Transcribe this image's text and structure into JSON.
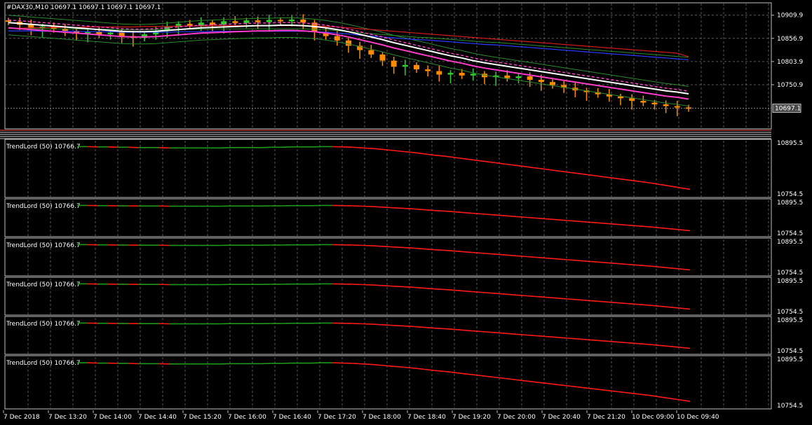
{
  "chart_data": {
    "type": "candlestick",
    "symbol_header": "#DAX30,M10  10697.1 10697.1 10697.1 10697.1",
    "bid_label": "10697.1",
    "price_axis": [
      "10909.9",
      "10856.9",
      "10803.9",
      "10750.9"
    ],
    "ylim": [
      10650,
      10935
    ],
    "x_axis_labels": [
      "7 Dec 2018",
      "7 Dec 13:20",
      "7 Dec 14:00",
      "7 Dec 14:40",
      "7 Dec 15:20",
      "7 Dec 16:00",
      "7 Dec 16:40",
      "7 Dec 17:20",
      "7 Dec 18:00",
      "7 Dec 18:40",
      "7 Dec 19:20",
      "7 Dec 20:00",
      "7 Dec 20:40",
      "7 Dec 21:20",
      "10 Dec 09:00",
      "10 Dec 09:40"
    ],
    "candle_close": [
      10895,
      10888,
      10880,
      10884,
      10878,
      10874,
      10868,
      10872,
      10866,
      10870,
      10862,
      10858,
      10866,
      10874,
      10883,
      10890,
      10886,
      10893,
      10888,
      10896,
      10892,
      10898,
      10894,
      10899,
      10896,
      10900,
      10893,
      10872,
      10862,
      10852,
      10840,
      10830,
      10820,
      10806,
      10792,
      10796,
      10786,
      10782,
      10774,
      10778,
      10772,
      10776,
      10768,
      10772,
      10766,
      10770,
      10762,
      10757,
      10750,
      10744,
      10738,
      10734,
      10729,
      10724,
      10720,
      10714,
      10710,
      10706,
      10702,
      10699,
      10697
    ],
    "ma_white": [
      10893,
      10891,
      10889,
      10887,
      10885,
      10883,
      10881,
      10879,
      10877,
      10875,
      10873,
      10872,
      10872,
      10873,
      10875,
      10877,
      10879,
      10881,
      10882,
      10883,
      10884,
      10885,
      10886,
      10886,
      10887,
      10887,
      10886,
      10884,
      10881,
      10877,
      10872,
      10866,
      10860,
      10854,
      10847,
      10841,
      10835,
      10829,
      10823,
      10817,
      10812,
      10806,
      10801,
      10797,
      10793,
      10789,
      10785,
      10781,
      10777,
      10773,
      10769,
      10765,
      10761,
      10757,
      10753,
      10749,
      10745,
      10741,
      10737,
      10734,
      10730
    ],
    "ma_blue": [
      10874,
      10874,
      10874,
      10873,
      10873,
      10873,
      10873,
      10872,
      10872,
      10872,
      10871,
      10871,
      10871,
      10871,
      10871,
      10872,
      10872,
      10872,
      10873,
      10873,
      10873,
      10873,
      10873,
      10873,
      10873,
      10873,
      10873,
      10872,
      10871,
      10869,
      10867,
      10864,
      10862,
      10860,
      10858,
      10856,
      10854,
      10853,
      10851,
      10849,
      10847,
      10845,
      10843,
      10842,
      10840,
      10838,
      10836,
      10834,
      10832,
      10830,
      10828,
      10826,
      10824,
      10822,
      10820,
      10818,
      10816,
      10814,
      10812,
      10810,
      10808
    ],
    "ma_red": [
      10880,
      10880,
      10881,
      10881,
      10882,
      10882,
      10882,
      10883,
      10883,
      10883,
      10883,
      10883,
      10884,
      10884,
      10884,
      10885,
      10885,
      10885,
      10886,
      10886,
      10886,
      10886,
      10886,
      10886,
      10886,
      10886,
      10886,
      10885,
      10884,
      10883,
      10881,
      10879,
      10877,
      10875,
      10873,
      10871,
      10869,
      10867,
      10865,
      10863,
      10861,
      10859,
      10857,
      10855,
      10853,
      10851,
      10849,
      10847,
      10845,
      10843,
      10841,
      10839,
      10837,
      10835,
      10833,
      10831,
      10829,
      10827,
      10825,
      10823,
      10815
    ],
    "band_offset": 28,
    "x_last_bar_offset_bars": 0,
    "indicator_panes": [
      {
        "label": "TrendLord (50) 10766.7",
        "axis_top": "10895.5",
        "axis_bottom": "10754.5"
      },
      {
        "label": "TrendLord (50) 10766.7",
        "axis_top": "10895.5",
        "axis_bottom": "10754.5"
      },
      {
        "label": "TrendLord (50) 10766.7",
        "axis_top": "10895.5",
        "axis_bottom": "10754.5"
      },
      {
        "label": "TrendLord (50) 10766.7",
        "axis_top": "10895.5",
        "axis_bottom": "10754.5"
      },
      {
        "label": "TrendLord (50) 10766.7",
        "axis_top": "10895.5",
        "axis_bottom": "10754.5"
      },
      {
        "label": "TrendLord (50) 10766.7",
        "axis_top": "10895.5",
        "axis_bottom": "10754.5"
      }
    ],
    "indicator_values": [
      10895,
      10895,
      10894,
      10894,
      10893,
      10893,
      10892,
      10892,
      10892,
      10891,
      10891,
      10891,
      10891,
      10891,
      10891,
      10892,
      10892,
      10892,
      10892,
      10893,
      10893,
      10894,
      10894,
      10894,
      10895,
      10895,
      10894,
      10893,
      10891,
      10889,
      10886,
      10883,
      10880,
      10877,
      10873,
      10869,
      10866,
      10862,
      10858,
      10854,
      10850,
      10846,
      10842,
      10838,
      10834,
      10830,
      10826,
      10822,
      10818,
      10814,
      10810,
      10806,
      10802,
      10798,
      10794,
      10790,
      10786,
      10781,
      10776,
      10771,
      10766
    ],
    "colors": {
      "background": "#000000",
      "grid": "#5a5a5a",
      "text": "#ffffff",
      "bull_candle": "#32cd32",
      "bear_candle": "#ff8c00",
      "ma_white": "#ffffff",
      "ma_blue": "#2b3bff",
      "ma_red": "#d41c1c",
      "ma_magenta": "#ff3cc8",
      "band": "#2e8b2e",
      "indicator_down": "#ff1a1a",
      "indicator_up": "#1f9a1f"
    }
  }
}
